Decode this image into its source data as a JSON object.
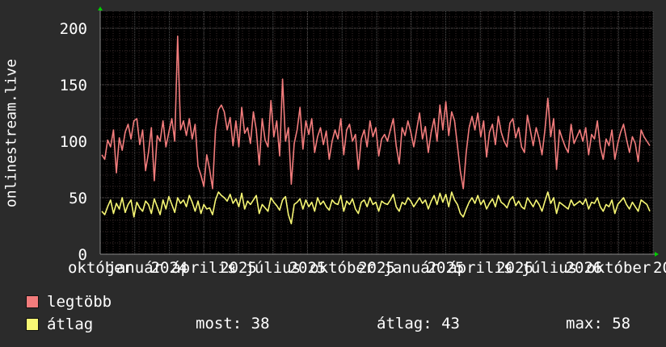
{
  "chart_data": {
    "type": "line",
    "ylabel": "onlinestream.live",
    "ylim": [
      0,
      215
    ],
    "y_ticks": [
      "0",
      "50",
      "100",
      "150",
      "200"
    ],
    "y_tick_values": [
      0,
      50,
      100,
      150,
      200
    ],
    "x_tick_labels": [
      "október",
      "január",
      "2024",
      "április",
      "2025",
      "július",
      "2025",
      "október",
      "2025",
      "január",
      "2025",
      "április",
      "2026",
      "július",
      "2026",
      "október",
      "20"
    ],
    "grid": true,
    "colors": {
      "background": "#2b2b2b",
      "plot_bg": "#000000",
      "grid_major": "#555555",
      "grid_minor": "#3a2a2a",
      "legtobb": "#f27c7c",
      "atlag": "#f7f774",
      "axis_arrow": "#00cc00"
    },
    "series": [
      {
        "name": "legtöbb",
        "values": [
          88,
          84,
          101,
          95,
          110,
          72,
          103,
          92,
          108,
          115,
          102,
          118,
          120,
          97,
          110,
          74,
          90,
          112,
          65,
          105,
          100,
          118,
          95,
          108,
          120,
          100,
          193,
          110,
          118,
          105,
          120,
          102,
          115,
          78,
          70,
          60,
          88,
          75,
          58,
          110,
          128,
          132,
          126,
          110,
          121,
          96,
          118,
          95,
          130,
          107,
          112,
          98,
          126,
          110,
          79,
          120,
          101,
          95,
          136,
          104,
          118,
          87,
          155,
          100,
          112,
          62,
          98,
          110,
          130,
          93,
          118,
          106,
          120,
          90,
          104,
          112,
          97,
          109,
          84,
          100,
          110,
          102,
          120,
          88,
          110,
          115,
          100,
          106,
          75,
          102,
          110,
          95,
          118,
          104,
          112,
          87,
          102,
          106,
          100,
          110,
          120,
          96,
          80,
          112,
          105,
          118,
          108,
          95,
          110,
          125,
          102,
          113,
          90,
          108,
          120,
          100,
          132,
          110,
          135,
          105,
          126,
          118,
          96,
          73,
          58,
          90,
          112,
          122,
          110,
          125,
          104,
          118,
          86,
          108,
          115,
          97,
          122,
          108,
          100,
          95,
          116,
          120,
          103,
          112,
          95,
          90,
          123,
          110,
          96,
          112,
          102,
          88,
          110,
          138,
          104,
          120,
          75,
          110,
          102,
          95,
          90,
          115,
          98,
          104,
          110,
          100,
          112,
          88,
          106,
          102,
          118,
          95,
          84,
          102,
          96,
          110,
          84,
          98,
          108,
          115,
          102,
          90,
          104,
          98,
          82,
          110,
          104,
          100,
          96
        ],
        "samples": 188
      },
      {
        "name": "átlag",
        "values": [
          38,
          35,
          42,
          48,
          36,
          45,
          40,
          50,
          37,
          44,
          48,
          33,
          46,
          41,
          38,
          47,
          44,
          36,
          49,
          42,
          35,
          48,
          40,
          51,
          44,
          37,
          50,
          45,
          48,
          42,
          52,
          46,
          38,
          47,
          36,
          44,
          40,
          41,
          35,
          48,
          55,
          52,
          50,
          47,
          53,
          45,
          49,
          42,
          54,
          40,
          47,
          44,
          48,
          52,
          36,
          44,
          41,
          38,
          50,
          46,
          43,
          39,
          48,
          51,
          35,
          27,
          44,
          46,
          49,
          40,
          48,
          42,
          46,
          38,
          50,
          44,
          47,
          42,
          39,
          48,
          45,
          44,
          52,
          38,
          47,
          44,
          49,
          40,
          36,
          46,
          48,
          42,
          50,
          44,
          46,
          38,
          47,
          45,
          44,
          48,
          53,
          42,
          38,
          46,
          44,
          50,
          47,
          42,
          46,
          50,
          45,
          48,
          40,
          47,
          52,
          44,
          54,
          46,
          53,
          42,
          55,
          48,
          44,
          36,
          33,
          40,
          46,
          50,
          45,
          52,
          44,
          48,
          40,
          45,
          49,
          42,
          52,
          46,
          44,
          41,
          48,
          51,
          43,
          47,
          42,
          40,
          50,
          46,
          42,
          48,
          44,
          38,
          47,
          55,
          45,
          50,
          36,
          46,
          44,
          42,
          40,
          48,
          43,
          45,
          47,
          44,
          49,
          40,
          46,
          45,
          50,
          42,
          38,
          44,
          42,
          48,
          36,
          44,
          47,
          50,
          44,
          40,
          46,
          42,
          38,
          48,
          46,
          44,
          38
        ],
        "samples": 188
      }
    ]
  },
  "legend": {
    "items": [
      {
        "label": "legtöbb",
        "color": "#f27c7c"
      },
      {
        "label": "átlag",
        "color": "#f7f774"
      }
    ],
    "stats": {
      "most": "most: 38",
      "atlag": "átlag: 43",
      "max": "max: 58"
    }
  }
}
